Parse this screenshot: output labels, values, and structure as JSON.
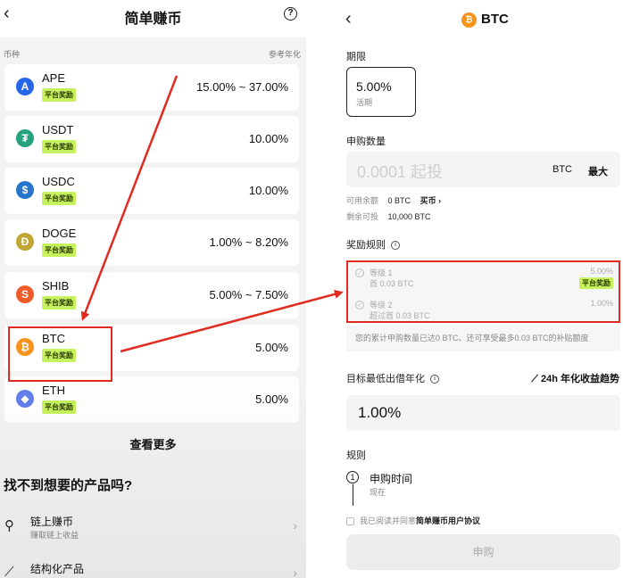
{
  "left": {
    "header": {
      "back": "‹",
      "title": "简单赚币",
      "help": "?"
    },
    "columns": {
      "coin": "币种",
      "apr": "参考年化"
    },
    "coins": [
      {
        "name": "APE",
        "badge": "平台奖励",
        "rate": "15.00% ~ 37.00%",
        "icon": "ape-icon",
        "color": "#2565e8",
        "glyph": "A"
      },
      {
        "name": "USDT",
        "badge": "平台奖励",
        "rate": "10.00%",
        "icon": "usdt-icon",
        "color": "#26a17b",
        "glyph": "₮"
      },
      {
        "name": "USDC",
        "badge": "平台奖励",
        "rate": "10.00%",
        "icon": "usdc-icon",
        "color": "#2775ca",
        "glyph": "$"
      },
      {
        "name": "DOGE",
        "badge": "平台奖励",
        "rate": "1.00% ~ 8.20%",
        "icon": "doge-icon",
        "color": "#c2a633",
        "glyph": "Ð"
      },
      {
        "name": "SHIB",
        "badge": "平台奖励",
        "rate": "5.00% ~ 7.50%",
        "icon": "shib-icon",
        "color": "#f05a28",
        "glyph": "S"
      },
      {
        "name": "BTC",
        "badge": "平台奖励",
        "rate": "5.00%",
        "icon": "btc-icon",
        "color": "#f7931a",
        "glyph": "₿"
      },
      {
        "name": "ETH",
        "badge": "平台奖励",
        "rate": "5.00%",
        "icon": "eth-icon",
        "color": "#627eea",
        "glyph": "◆"
      }
    ],
    "see_more": "查看更多",
    "find_title": "找不到想要的产品吗?",
    "products": [
      {
        "title": "链上赚币",
        "subtitle": "赚取链上收益"
      },
      {
        "title": "结构化产品",
        "subtitle": ""
      }
    ]
  },
  "right": {
    "header": {
      "back": "‹",
      "title": "BTC",
      "coin_glyph": "₿"
    },
    "term": {
      "label": "期限",
      "rate": "5.00%",
      "type": "活期"
    },
    "amount": {
      "label": "申购数量",
      "placeholder": "0.0001 起投",
      "unit": "BTC",
      "max": "最大"
    },
    "available": {
      "label": "可用余额",
      "value": "0 BTC",
      "buy": "买币 ›"
    },
    "remaining": {
      "label": "剩余可投",
      "value": "10,000 BTC"
    },
    "reward": {
      "label": "奖励规则",
      "tiers": [
        {
          "name": "等级 1",
          "desc": "首 0.03 BTC",
          "rate": "5.00%",
          "badge": "平台奖励"
        },
        {
          "name": "等级 2",
          "desc": "超过首 0.03 BTC",
          "rate": "1.00%",
          "badge": ""
        }
      ],
      "note": "您的累计申购数量已达0 BTC。还可享受最多0.03 BTC的补贴额度"
    },
    "min_rate": {
      "label": "目标最低出借年化",
      "trend": "24h 年化收益趋势",
      "value": "1.00%"
    },
    "rules": {
      "label": "规则",
      "step_num": "1",
      "step_title": "申购时间",
      "step_sub": "现在"
    },
    "agree": {
      "prefix": "我已阅读并同意",
      "link": "简单赚币用户协议"
    },
    "submit": "申购"
  },
  "colors": {
    "badge": "#c6f25e",
    "highlight": "#e02b20",
    "btc": "#f7931a"
  }
}
